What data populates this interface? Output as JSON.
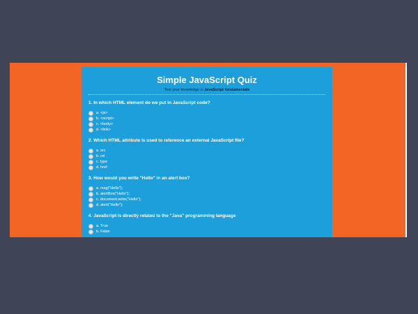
{
  "quiz": {
    "title": "Simple JavaScript Quiz",
    "subtitle_prefix": "Test your knowledge in ",
    "subtitle_bold": "JavaScript fundamentals",
    "questions": [
      {
        "text": "1. In which HTML element do we put in JavaScript code?",
        "options": [
          "a. <js>",
          "b. <script>",
          "c. <body>",
          "d. <link>"
        ]
      },
      {
        "text": "2. Which HTML attribute is used to reference an external JavaScript file?",
        "options": [
          "a. src",
          "b. rel",
          "c. type",
          "d. href"
        ]
      },
      {
        "text": "3. How would you write \"Hello\" in an alert box?",
        "options": [
          "a. msg(\"Hello\");",
          "b. alertBox(\"Hello\");",
          "c. document.write(\"Hello\");",
          "d. alert(\"Hello\");"
        ]
      },
      {
        "text": "4. JavaScript is directly related to the \"Java\" programming language",
        "options": [
          "a. True",
          "b. False"
        ]
      }
    ]
  },
  "colors": {
    "page_background": "#3f4457",
    "stage_background": "#f26524",
    "quiz_background": "#1d9fdb"
  }
}
